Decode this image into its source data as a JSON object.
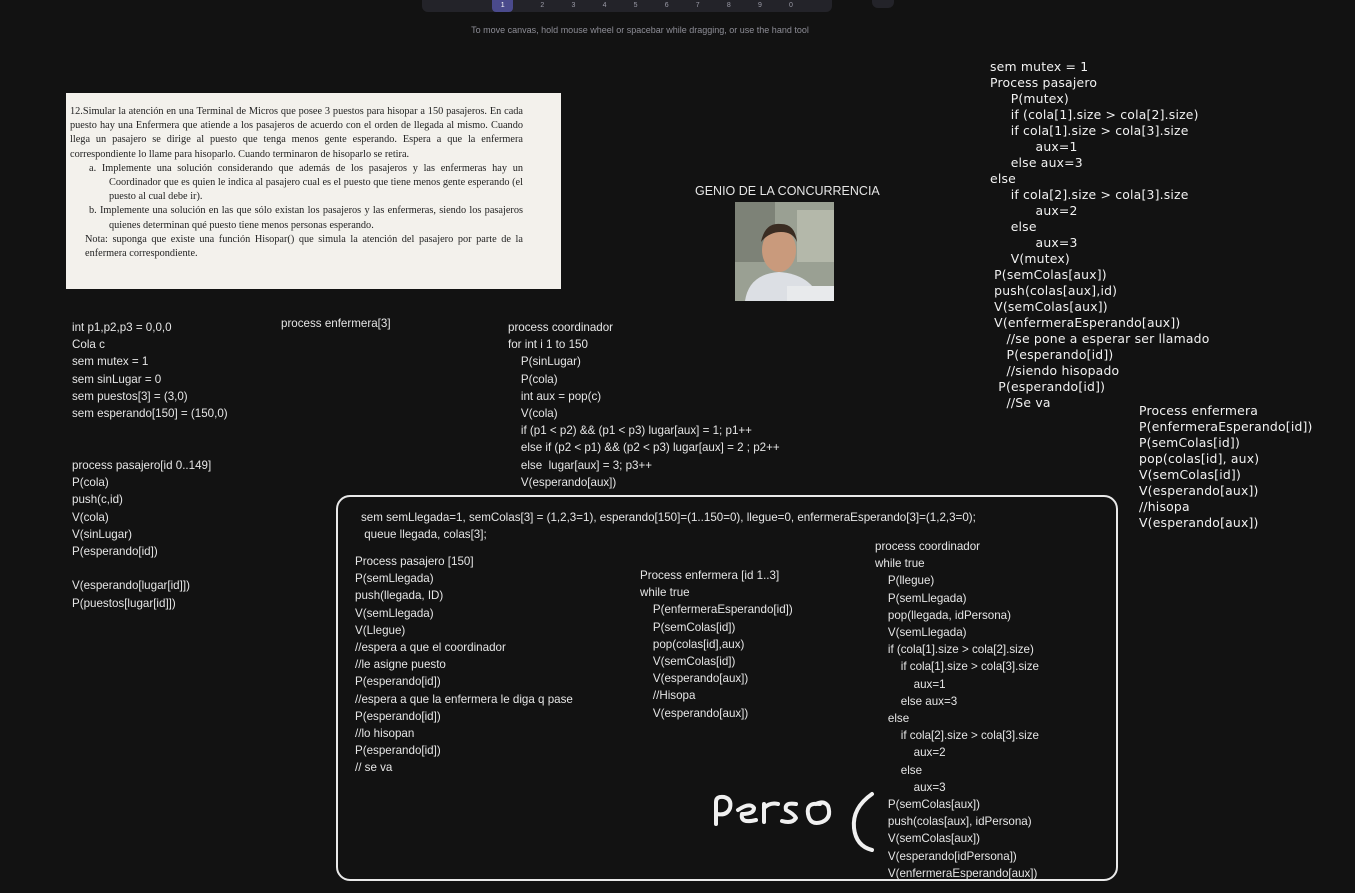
{
  "toolbar": {
    "buttons": [
      "",
      "",
      "1",
      "2",
      "3",
      "4",
      "5",
      "6",
      "7",
      "8",
      "9",
      "0",
      ""
    ]
  },
  "canvas_hint": "To move canvas, hold mouse wheel or spacebar while dragging, or use the hand tool",
  "exercise": {
    "paragraph": "12.Simular la atención en una Terminal de Micros que posee 3 puestos para hisopar a 150 pasajeros. En cada puesto hay una Enfermera que atiende a los pasajeros de acuerdo con el orden de llegada al mismo. Cuando llega un pasajero se dirige al puesto que tenga menos gente esperando. Espera a que la enfermera correspondiente lo llame para hisoparlo. Cuando terminaron de hisoparlo se retira.",
    "item_a": "a.   Implemente una solución considerando que además de los pasajeros y las enfermeras hay un Coordinador que es quien le indica al pasajero cual es el puesto que tiene menos gente esperando (el puesto al cual debe ir).",
    "item_b": "b.   Implemente una solución en las que sólo existan los pasajeros y las enfermeras, siendo los pasajeros quienes determinan qué puesto tiene menos personas esperando.",
    "nota": "Nota: suponga que existe una función Hisopar() que simula la atención del pasajero por parte de la enfermera correspondiente."
  },
  "genio_label": "GENIO DE LA CONCURRENCIA",
  "text_decls": "int p1,p2,p3 = 0,0,0\nCola c\nsem mutex = 1\nsem sinLugar = 0\nsem puestos[3] = (3,0)\nsem esperando[150] = (150,0)",
  "text_pasajero": "process pasajero[id 0..149]\nP(cola)\npush(c,id)\nV(cola)\nV(sinLugar)\nP(esperando[id])\n\nV(esperando[lugar[id]])\nP(puestos[lugar[id]])",
  "text_enfermera_hdr": "process enfermera[3]",
  "text_coordinador": "process coordinador\nfor int i 1 to 150\n    P(sinLugar)\n    P(cola)\n    int aux = pop(c)\n    V(cola)\n    if (p1 < p2) && (p1 < p3) lugar[aux] = 1; p1++\n    else if (p2 < p1) && (p2 < p3) lugar[aux] = 2 ; p2++\n    else  lugar[aux] = 3; p3++\n    V(esperando[aux])",
  "hand_pasajero": "sem mutex = 1\nProcess pasajero\n     P(mutex)\n     if (cola[1].size > cola[2].size)\n     if cola[1].size > cola[3].size\n           aux=1\n     else aux=3\nelse\n     if cola[2].size > cola[3].size\n           aux=2\n     else\n           aux=3\n     V(mutex)\n P(semColas[aux])\n push(colas[aux],id)\n V(semColas[aux])\n V(enfermeraEsperando[aux])\n    //se pone a esperar ser llamado\n    P(esperando[id])\n    //siendo hisopado\n  P(esperando[id])\n    //Se va",
  "hand_enfermera": "Process enfermera\nP(enfermeraEsperando[id])\nP(semColas[id])\npop(colas[id], aux)\nV(semColas[id])\nV(esperando[aux])\n//hisopa\nV(esperando[aux])",
  "box_header": "sem semLlegada=1, semColas[3] = (1,2,3=1), esperando[150]=(1..150=0), llegue=0, enfermeraEsperando[3]=(1,2,3=0);\n queue llegada, colas[3];",
  "box_pasajero": "Process pasajero [150]\nP(semLlegada)\npush(llegada, ID)\nV(semLlegada)\nV(Llegue)\n//espera a que el coordinador\n//le asigne puesto\nP(esperando[id])\n//espera a que la enfermera le diga q pase\nP(esperando[id])\n//lo hisopan\nP(esperando[id])\n// se va",
  "box_enfermera": "Process enfermera [id 1..3]\nwhile true\n    P(enfermeraEsperando[id])\n    P(semColas[id])\n    pop(colas[id],aux)\n    V(semColas[id])\n    V(esperando[aux])\n    //Hisopa\n    V(esperando[aux])",
  "box_coordinador": "process coordinador\nwhile true\n    P(llegue)\n    P(semLlegada)\n    pop(llegada, idPersona)\n    V(semLlegada)\n    if (cola[1].size > cola[2].size)\n        if cola[1].size > cola[3].size\n            aux=1\n        else aux=3\n    else\n        if cola[2].size > cola[3].size\n            aux=2\n        else\n            aux=3\n    P(semColas[aux])\n    push(colas[aux], idPersona)\n    V(semColas[aux])\n    V(esperando[idPersona])\n    V(enfermeraEsperando[aux])",
  "colors": {
    "background": "#121212",
    "toolbar": "#232329",
    "active_tool": "#4a4a8c",
    "text": "#e6e6e6"
  }
}
